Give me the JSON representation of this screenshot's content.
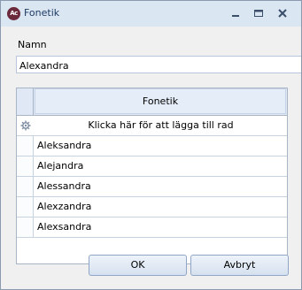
{
  "window": {
    "title": "Fonetik",
    "app_icon_text": "Ac",
    "brand_color": "#6b2a3c"
  },
  "form": {
    "name_label": "Namn",
    "name_value": "Alexandra"
  },
  "grid": {
    "column_header": "Fonetik",
    "new_row_text": "Klicka här för att lägga till rad",
    "rows": [
      "Aleksandra",
      "Alejandra",
      "Alessandra",
      "Alexzandra",
      "Alexsandra"
    ]
  },
  "buttons": {
    "ok": "OK",
    "cancel": "Avbryt"
  }
}
